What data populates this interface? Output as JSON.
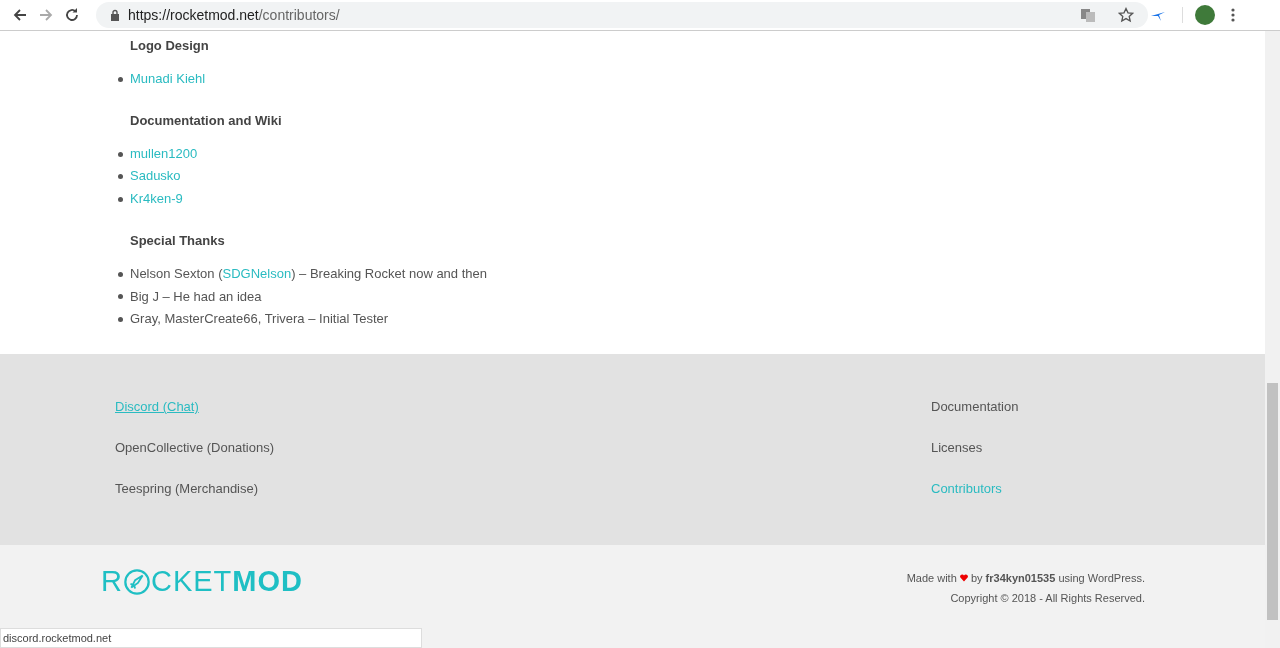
{
  "browser": {
    "url_host": "https://rocketmod.net",
    "url_path": "/contributors/"
  },
  "sections": [
    {
      "title": "Logo Design",
      "items": [
        {
          "link": "Munadi Kiehl"
        }
      ]
    },
    {
      "title": "Documentation and Wiki",
      "items": [
        {
          "link": "mullen1200"
        },
        {
          "link": "Sadusko"
        },
        {
          "link": "Kr4ken-9"
        }
      ]
    },
    {
      "title": "Special Thanks",
      "items": [
        {
          "before": "Nelson Sexton (",
          "link": "SDGNelson",
          "after": ") – Breaking Rocket now and then"
        },
        {
          "before": "Big J – He had an idea"
        },
        {
          "before": "Gray, MasterCreate66, Trivera – Initial Tester"
        }
      ]
    }
  ],
  "footer_left": [
    {
      "label": "Discord (Chat)",
      "hovered": true
    },
    {
      "label": "OpenCollective (Donations)",
      "hovered": false
    },
    {
      "label": "Teespring (Merchandise)",
      "hovered": false
    }
  ],
  "footer_right": [
    {
      "label": "Documentation",
      "selected": false
    },
    {
      "label": "Licenses",
      "selected": false
    },
    {
      "label": "Contributors",
      "selected": true
    }
  ],
  "logo": {
    "light_start": "R",
    "light_end": "CKET",
    "bold": "MOD"
  },
  "credits": {
    "made_with": "Made with",
    "by": "by",
    "author": "fr34kyn01535",
    "using": "using WordPress.",
    "copyright": "Copyright © 2018 - All Rights Reserved."
  },
  "status_url": "discord.rocketmod.net"
}
